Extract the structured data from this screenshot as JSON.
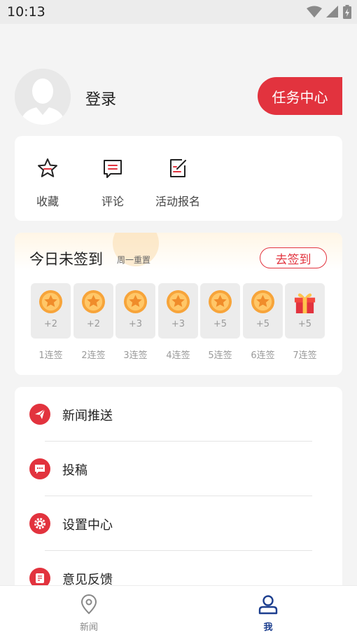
{
  "status_bar": {
    "time": "10:13"
  },
  "profile": {
    "login_label": "登录",
    "task_center_label": "任务中心"
  },
  "quick_actions": [
    {
      "label": "收藏",
      "icon": "star-icon"
    },
    {
      "label": "评论",
      "icon": "comment-icon"
    },
    {
      "label": "活动报名",
      "icon": "signup-form-icon"
    }
  ],
  "sign_in": {
    "title": "今日未签到",
    "subtitle": "周一重置",
    "button_label": "去签到",
    "days": [
      {
        "points": "+2",
        "label": "1连签",
        "icon": "coin-icon"
      },
      {
        "points": "+2",
        "label": "2连签",
        "icon": "coin-icon"
      },
      {
        "points": "+3",
        "label": "3连签",
        "icon": "coin-icon"
      },
      {
        "points": "+3",
        "label": "4连签",
        "icon": "coin-icon"
      },
      {
        "points": "+5",
        "label": "5连签",
        "icon": "coin-icon"
      },
      {
        "points": "+5",
        "label": "6连签",
        "icon": "coin-icon"
      },
      {
        "points": "+5",
        "label": "7连签",
        "icon": "gift-icon"
      }
    ]
  },
  "menu": [
    {
      "label": "新闻推送",
      "icon": "paper-plane-icon"
    },
    {
      "label": "投稿",
      "icon": "message-icon"
    },
    {
      "label": "设置中心",
      "icon": "gear-icon"
    },
    {
      "label": "意见反馈",
      "icon": "feedback-icon"
    }
  ],
  "bottom_nav": [
    {
      "label": "新闻",
      "icon": "location-pin-icon",
      "active": false
    },
    {
      "label": "我",
      "icon": "user-icon",
      "active": true
    }
  ],
  "colors": {
    "accent": "#e2333e",
    "active_nav": "#1d3f8f",
    "inactive_nav": "#888888"
  }
}
